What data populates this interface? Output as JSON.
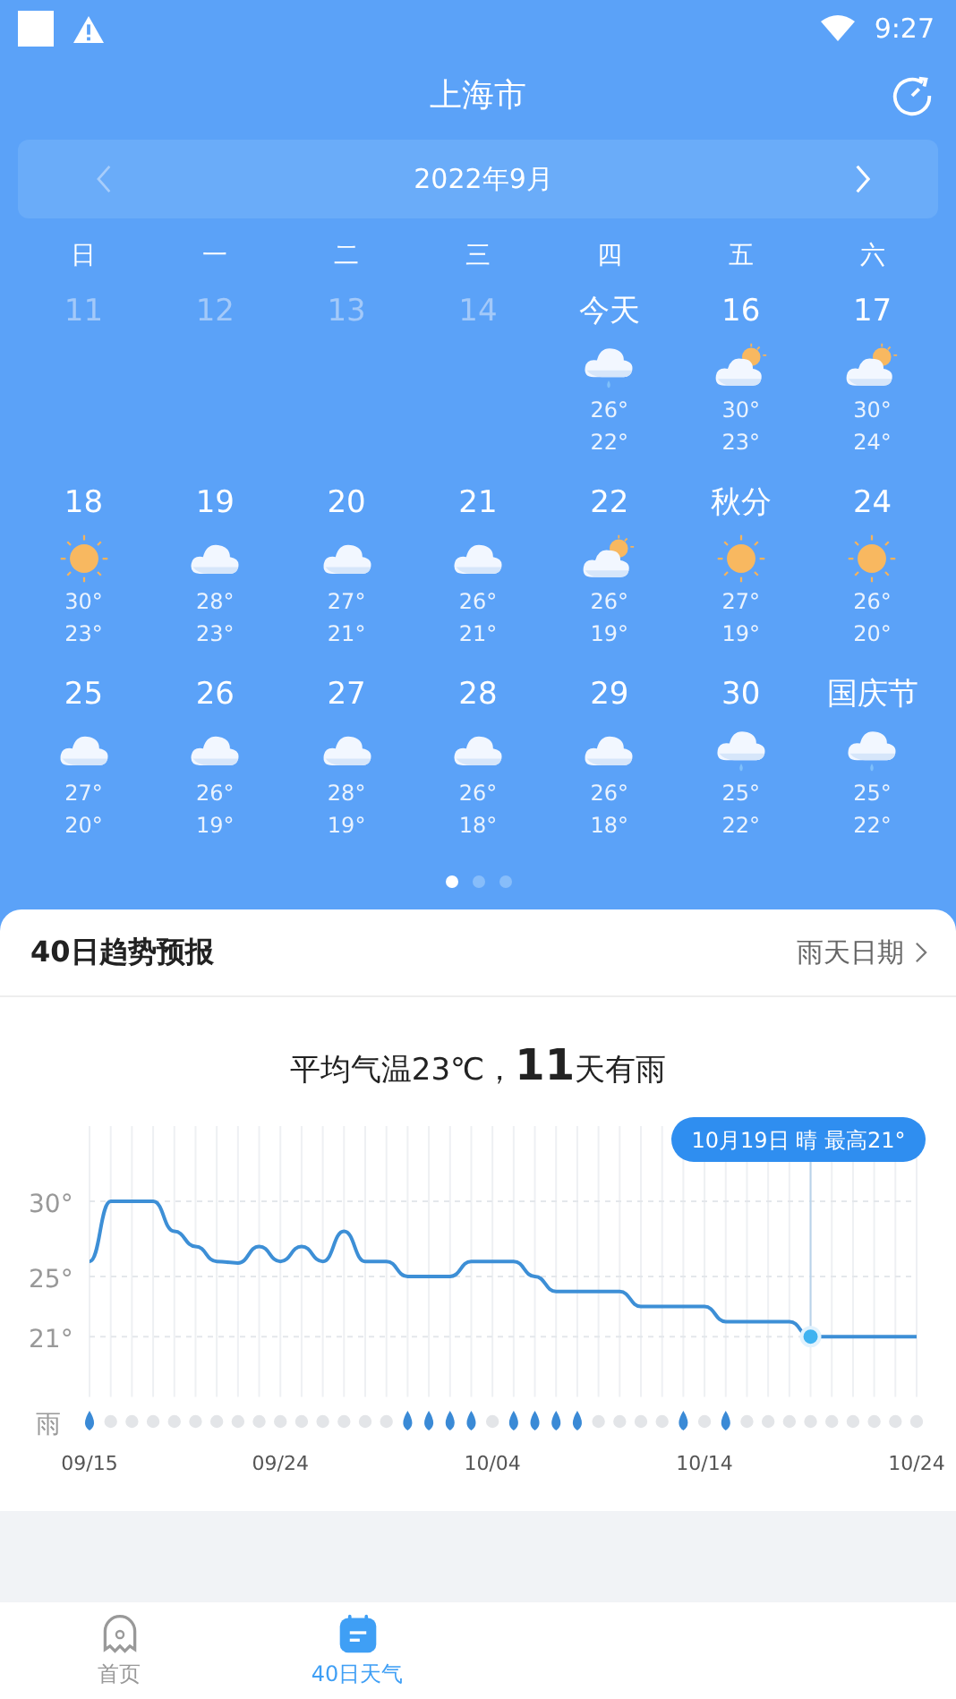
{
  "status_bar": {
    "time": "9:27"
  },
  "header": {
    "city": "上海市",
    "month": "2022年9月"
  },
  "weekdays": [
    "日",
    "一",
    "二",
    "三",
    "四",
    "五",
    "六"
  ],
  "weeks": [
    [
      {
        "label": "11",
        "past": true
      },
      {
        "label": "12",
        "past": true
      },
      {
        "label": "13",
        "past": true
      },
      {
        "label": "14",
        "past": true
      },
      {
        "label": "今天",
        "past": false,
        "kind": "rain",
        "high": "26°",
        "low": "22°"
      },
      {
        "label": "16",
        "past": false,
        "kind": "partly_cloudy",
        "high": "30°",
        "low": "23°"
      },
      {
        "label": "17",
        "past": false,
        "kind": "partly_cloudy",
        "high": "30°",
        "low": "24°"
      }
    ],
    [
      {
        "label": "18",
        "past": false,
        "kind": "sunny",
        "high": "30°",
        "low": "23°"
      },
      {
        "label": "19",
        "past": false,
        "kind": "cloudy",
        "high": "28°",
        "low": "23°"
      },
      {
        "label": "20",
        "past": false,
        "kind": "cloudy",
        "high": "27°",
        "low": "21°"
      },
      {
        "label": "21",
        "past": false,
        "kind": "cloudy",
        "high": "26°",
        "low": "21°"
      },
      {
        "label": "22",
        "past": false,
        "kind": "partly_cloudy",
        "high": "26°",
        "low": "19°"
      },
      {
        "label": "秋分",
        "past": false,
        "kind": "sunny",
        "high": "27°",
        "low": "19°"
      },
      {
        "label": "24",
        "past": false,
        "kind": "sunny",
        "high": "26°",
        "low": "20°"
      }
    ],
    [
      {
        "label": "25",
        "past": false,
        "kind": "cloudy",
        "high": "27°",
        "low": "20°"
      },
      {
        "label": "26",
        "past": false,
        "kind": "cloudy",
        "high": "26°",
        "low": "19°"
      },
      {
        "label": "27",
        "past": false,
        "kind": "cloudy",
        "high": "28°",
        "low": "19°"
      },
      {
        "label": "28",
        "past": false,
        "kind": "cloudy",
        "high": "26°",
        "low": "18°"
      },
      {
        "label": "29",
        "past": false,
        "kind": "cloudy",
        "high": "26°",
        "low": "18°"
      },
      {
        "label": "30",
        "past": false,
        "kind": "rain",
        "high": "25°",
        "low": "22°"
      },
      {
        "label": "国庆节",
        "past": false,
        "kind": "rain",
        "high": "25°",
        "low": "22°"
      }
    ]
  ],
  "pager": [
    {
      "selected": true
    },
    {
      "selected": false
    },
    {
      "selected": false
    }
  ],
  "trend": {
    "title": "40日趋势预报",
    "link": "雨天日期",
    "summary": "平均气温23℃，**11**天有雨",
    "rain_label": "雨",
    "days": [
      {
        "rain": true,
        "selected": false
      },
      {
        "rain": false,
        "selected": false
      },
      {
        "rain": false,
        "selected": false
      },
      {
        "rain": false,
        "selected": false
      },
      {
        "rain": false,
        "selected": false
      },
      {
        "rain": false,
        "selected": false
      },
      {
        "rain": false,
        "selected": false
      },
      {
        "rain": false,
        "selected": false
      },
      {
        "rain": false,
        "selected": false
      },
      {
        "rain": false,
        "selected": false
      },
      {
        "rain": false,
        "selected": false
      },
      {
        "rain": false,
        "selected": false
      },
      {
        "rain": false,
        "selected": false
      },
      {
        "rain": false,
        "selected": false
      },
      {
        "rain": false,
        "selected": false
      },
      {
        "rain": true,
        "selected": false
      },
      {
        "rain": true,
        "selected": false
      },
      {
        "rain": true,
        "selected": false
      },
      {
        "rain": true,
        "selected": false
      },
      {
        "rain": false,
        "selected": false
      },
      {
        "rain": true,
        "selected": false
      },
      {
        "rain": true,
        "selected": false
      },
      {
        "rain": true,
        "selected": false
      },
      {
        "rain": true,
        "selected": false
      },
      {
        "rain": false,
        "selected": false
      },
      {
        "rain": false,
        "selected": false
      },
      {
        "rain": false,
        "selected": false
      },
      {
        "rain": false,
        "selected": false
      },
      {
        "rain": true,
        "selected": false
      },
      {
        "rain": false,
        "selected": false
      },
      {
        "rain": true,
        "selected": false
      },
      {
        "rain": false,
        "selected": false
      },
      {
        "rain": false,
        "selected": false
      },
      {
        "rain": false,
        "selected": false
      },
      {
        "rain": false,
        "selected": true
      },
      {
        "rain": false,
        "selected": false
      },
      {
        "rain": false,
        "selected": false
      },
      {
        "rain": false,
        "selected": false
      },
      {
        "rain": false,
        "selected": false
      },
      {
        "rain": false,
        "selected": false
      }
    ],
    "chart_data": {
      "type": "line",
      "categories": [
        "09/15",
        null,
        null,
        null,
        null,
        null,
        null,
        null,
        null,
        "09/24",
        null,
        null,
        null,
        null,
        null,
        null,
        null,
        null,
        null,
        "10/04",
        null,
        null,
        null,
        null,
        null,
        null,
        null,
        null,
        null,
        "10/14",
        null,
        null,
        null,
        null,
        null,
        null,
        null,
        null,
        null,
        "10/24"
      ],
      "values": [
        26,
        30,
        30,
        30,
        28,
        27,
        26,
        25.9,
        27,
        26,
        27,
        26,
        28,
        26,
        26,
        25,
        25,
        25,
        26,
        26,
        26,
        25,
        24,
        24,
        24,
        24,
        23,
        23,
        23,
        23,
        22,
        22,
        22,
        22,
        21,
        21,
        21,
        21,
        21,
        21
      ],
      "ylim": [
        17,
        35
      ],
      "grid": true,
      "yticks": [
        {
          "value": 30,
          "label": "30°"
        },
        {
          "value": 25,
          "label": "25°"
        },
        {
          "value": 21,
          "label": "21°"
        }
      ],
      "annotations": [
        "10月19日 晴 最高21°"
      ]
    }
  },
  "nav": [
    {
      "label": "首页",
      "selected": false
    },
    {
      "label": "40日天气",
      "selected": true
    }
  ]
}
